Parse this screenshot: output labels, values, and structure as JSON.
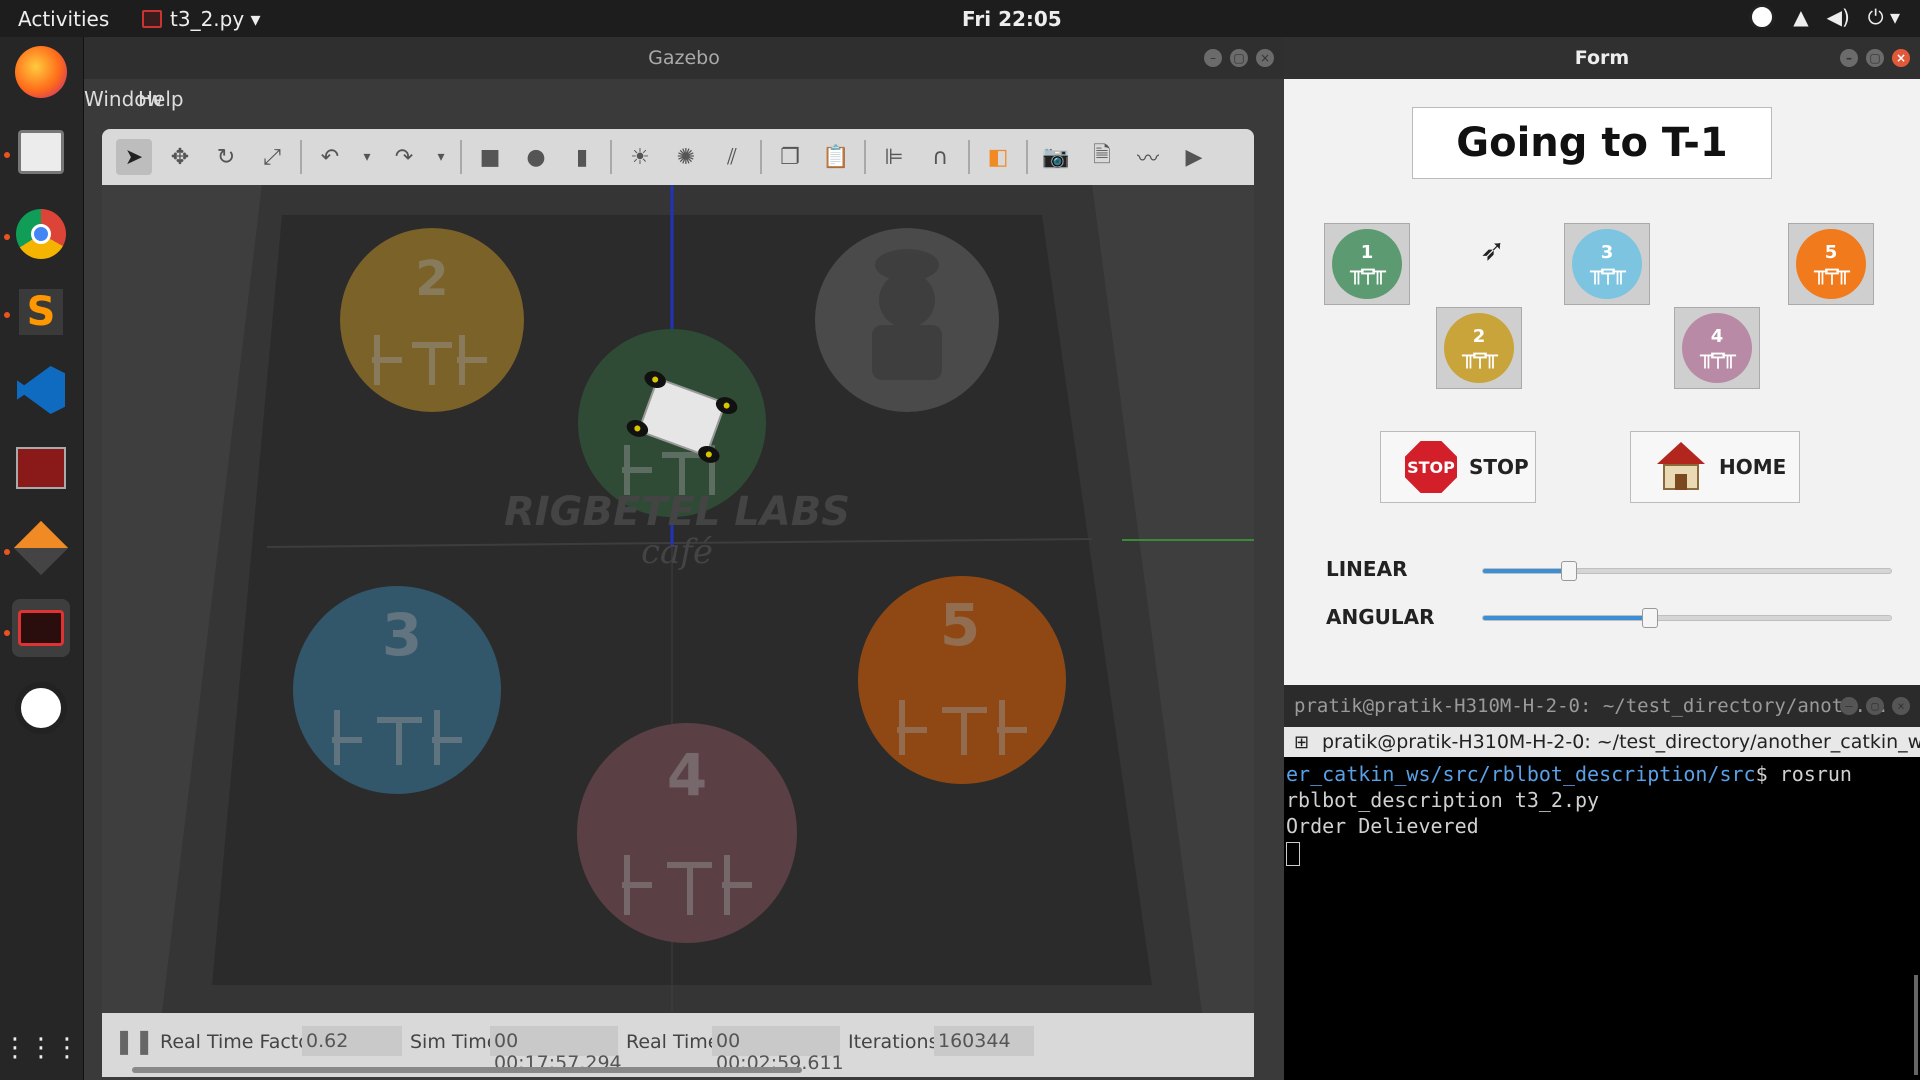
{
  "topbar": {
    "activities": "Activities",
    "app_menu": "t3_2.py ▾",
    "clock": "Fri 22:05"
  },
  "gazebo": {
    "title": "Gazebo",
    "menu": [
      "Window",
      "Help"
    ],
    "scene_watermark_1": "RIGBETEL LABS",
    "scene_watermark_2": "café",
    "tables": [
      "2",
      "3",
      "4",
      "5",
      "1"
    ],
    "status": {
      "real_time_factor_label": "Real Time Factor:",
      "real_time_factor": "0.62",
      "sim_time_label": "Sim Time:",
      "sim_time": "00 00:17:57.294",
      "real_time_label": "Real Time:",
      "real_time": "00 00:02:59.611",
      "iterations_label": "Iterations:",
      "iterations": "160344"
    }
  },
  "form": {
    "title": "Form",
    "goal": "Going to T-1",
    "table_buttons": [
      {
        "label": "1",
        "color": "#5c9a72"
      },
      {
        "label": "2",
        "color": "#c9a43a"
      },
      {
        "label": "3",
        "color": "#7cc4df"
      },
      {
        "label": "4",
        "color": "#b88aa6"
      },
      {
        "label": "5",
        "color": "#f07a1c"
      }
    ],
    "stop_icon_text": "STOP",
    "stop_label": "STOP",
    "home_label": "HOME",
    "linear_label": "LINEAR",
    "angular_label": "ANGULAR",
    "linear_value": 0.21,
    "angular_value": 0.41
  },
  "terminal": {
    "title": "pratik@pratik-H310M-H-2-0: ~/test_directory/anoth...",
    "tab": "pratik@pratik-H310M-H-2-0: ~/test_directory/another_catkin_w",
    "line1_path": "er_catkin_ws/src/rblbot_description/src",
    "line1_cmd": "$ rosrun",
    "line2": "rblbot_description t3_2.py",
    "line3": "Order Delievered"
  }
}
